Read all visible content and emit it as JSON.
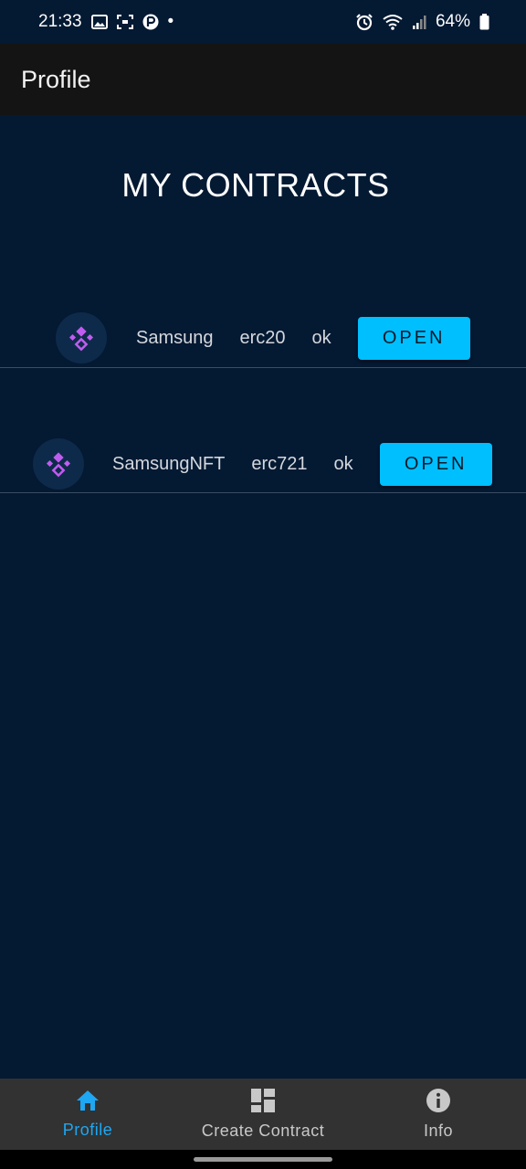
{
  "status_bar": {
    "time": "21:33",
    "dot": "•",
    "battery_percent": "64%",
    "icons_left": [
      "gallery-icon",
      "screenshot-icon",
      "app-notification-icon"
    ],
    "icons_right": [
      "alarm-icon",
      "wifi-icon",
      "signal-icon",
      "battery-icon"
    ]
  },
  "app_bar": {
    "title": "Profile"
  },
  "main": {
    "heading": "MY CONTRACTS",
    "contracts": [
      {
        "name": "Samsung",
        "standard": "erc20",
        "status": "ok",
        "button_label": "OPEN",
        "icon": "binance-coin-icon"
      },
      {
        "name": "SamsungNFT",
        "standard": "erc721",
        "status": "ok",
        "button_label": "OPEN",
        "icon": "binance-coin-icon"
      }
    ]
  },
  "bottom_nav": {
    "items": [
      {
        "label": "Profile",
        "icon": "home-icon",
        "active": true
      },
      {
        "label": "Create Contract",
        "icon": "dashboard-icon",
        "active": false
      },
      {
        "label": "Info",
        "icon": "info-icon",
        "active": false
      }
    ]
  },
  "colors": {
    "background": "#041932",
    "app_bar": "#141414",
    "accent": "#00bfff",
    "nav_active": "#1ea7f3",
    "nav_bar": "#323232",
    "coin_icon": "#c05cf0"
  }
}
